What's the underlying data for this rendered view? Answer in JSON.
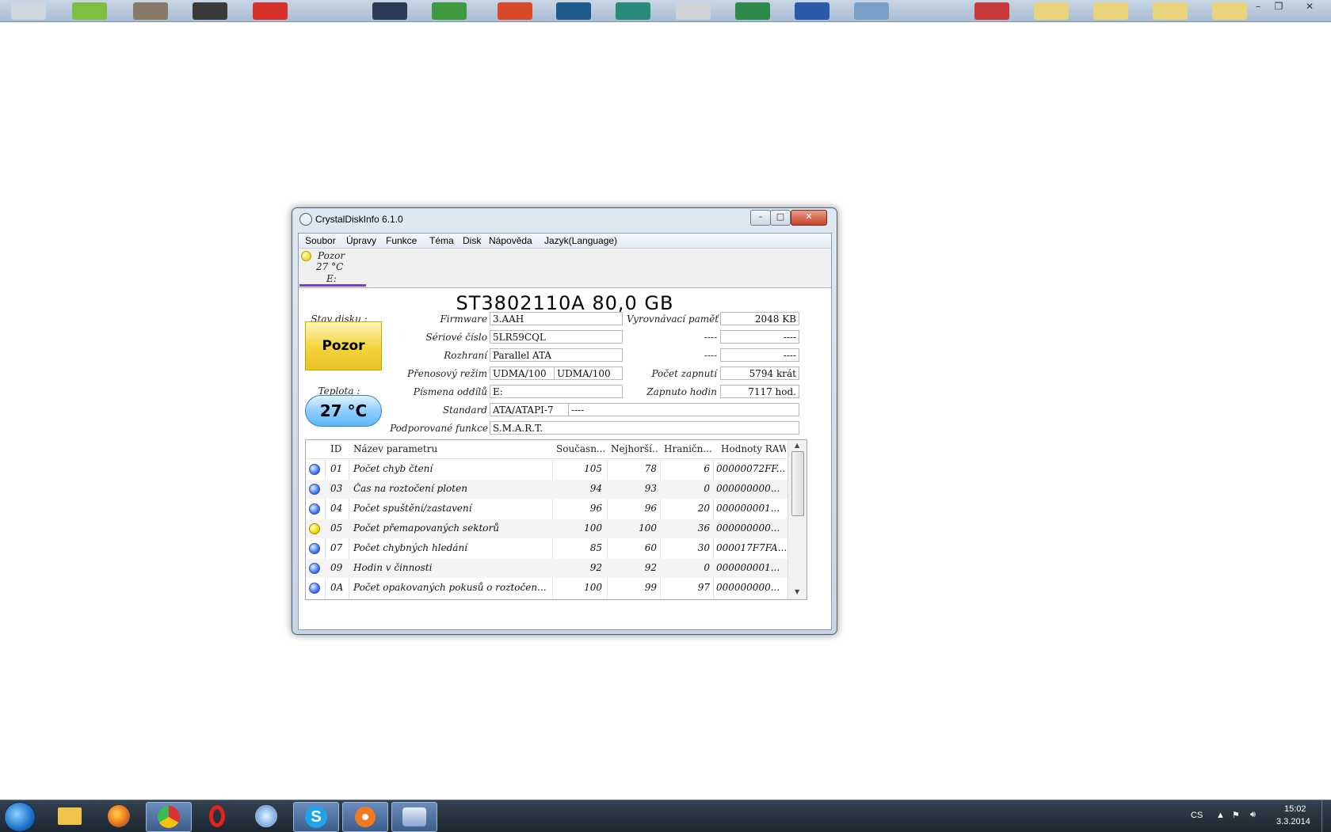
{
  "top_bar": {
    "icons": [
      "launcher-icon-1",
      "launcher-icon-2",
      "launcher-icon-3",
      "launcher-icon-4",
      "launcher-icon-5",
      "launcher-icon-6",
      "launcher-icon-7",
      "launcher-icon-8",
      "launcher-icon-9",
      "launcher-icon-10",
      "launcher-icon-11",
      "launcher-icon-12",
      "launcher-icon-13",
      "launcher-icon-14",
      "launcher-icon-15",
      "launcher-icon-16",
      "launcher-icon-17",
      "launcher-icon-18",
      "launcher-icon-19"
    ],
    "minimize": "–",
    "restore": "❐",
    "close": "✕"
  },
  "window": {
    "title": "CrystalDiskInfo 6.1.0",
    "minimize": "–",
    "maximize": "□",
    "close": "✕"
  },
  "menu": [
    "Soubor",
    "Úpravy",
    "Funkce",
    "Téma",
    "Disk",
    "Nápověda",
    "Jazyk(Language)"
  ],
  "drive_tab": {
    "status": "Pozor",
    "temperature": "27 °C",
    "letter": "E:"
  },
  "disk": {
    "model": "ST3802110A 80,0 GB",
    "status_label": "Stav disku :",
    "status_value": "Pozor",
    "temp_label": "Teplota :",
    "temp_value": "27 °C",
    "firmware_label": "Firmware",
    "firmware": "3.AAH",
    "serial_label": "Sériové číslo",
    "serial": "5LR59CQL",
    "interface_label": "Rozhraní",
    "interface": "Parallel ATA",
    "transfer_label": "Přenosový režim",
    "transfer_a": "UDMA/100",
    "transfer_b": "UDMA/100",
    "letters_label": "Písmena oddílů",
    "letters": "E:",
    "standard_label": "Standard",
    "standard_a": "ATA/ATAPI-7",
    "standard_b": "----",
    "features_label": "Podporované funkce",
    "features": "S.M.A.R.T.",
    "buffer_label": "Vyrovnávací paměť",
    "buffer": "2048 KB",
    "blank1_label": "----",
    "blank1": "----",
    "blank2_label": "----",
    "blank2": "----",
    "power_count_label": "Počet zapnutí",
    "power_count": "5794 krát",
    "power_hours_label": "Zapnuto hodin",
    "power_hours": "7117 hod."
  },
  "smart": {
    "headers": [
      "ID",
      "Název parametru",
      "Současn...",
      "Nejhorší...",
      "Hraničn...",
      "Hodnoty RAW"
    ],
    "rows": [
      {
        "status": "blue",
        "id": "01",
        "name": "Počet chyb čtení",
        "current": "105",
        "worst": "78",
        "threshold": "6",
        "raw": "00000072FF..."
      },
      {
        "status": "blue",
        "id": "03",
        "name": "Čas na roztočení ploten",
        "current": "94",
        "worst": "93",
        "threshold": "0",
        "raw": "000000000..."
      },
      {
        "status": "blue",
        "id": "04",
        "name": "Počet spuštění/zastavení",
        "current": "96",
        "worst": "96",
        "threshold": "20",
        "raw": "000000001..."
      },
      {
        "status": "yellow",
        "id": "05",
        "name": "Počet přemapovaných sektorů",
        "current": "100",
        "worst": "100",
        "threshold": "36",
        "raw": "000000000..."
      },
      {
        "status": "blue",
        "id": "07",
        "name": "Počet chybných hledání",
        "current": "85",
        "worst": "60",
        "threshold": "30",
        "raw": "000017F7FA..."
      },
      {
        "status": "blue",
        "id": "09",
        "name": "Hodin v činnosti",
        "current": "92",
        "worst": "92",
        "threshold": "0",
        "raw": "000000001..."
      },
      {
        "status": "blue",
        "id": "0A",
        "name": "Počet opakovaných pokusů o roztočen...",
        "current": "100",
        "worst": "99",
        "threshold": "97",
        "raw": "000000000..."
      }
    ]
  },
  "taskbar": {
    "apps": [
      "folder-icon",
      "firefox-icon",
      "chrome-icon",
      "opera-icon",
      "safari-icon",
      "skype-icon",
      "media-icon",
      "crystaldiskinfo-icon"
    ],
    "language": "CS",
    "time": "15:02",
    "date": "3.3.2014"
  }
}
